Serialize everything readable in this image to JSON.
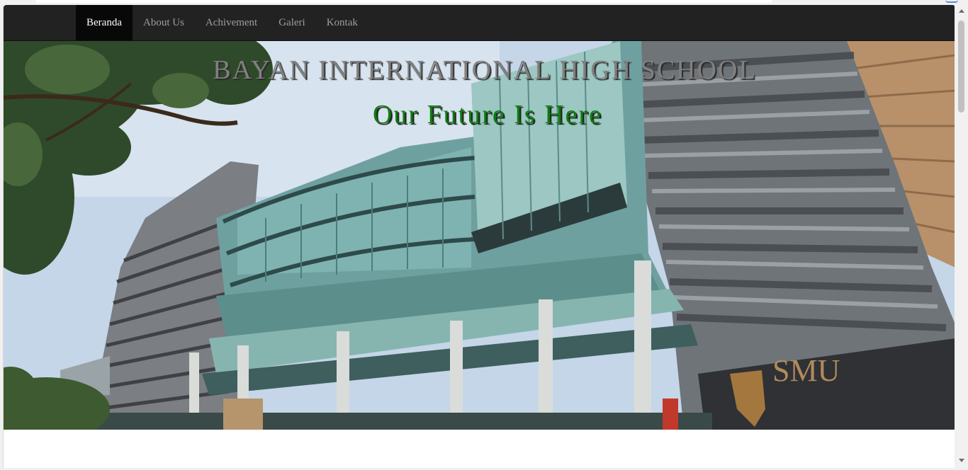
{
  "nav": {
    "items": [
      {
        "label": "Beranda",
        "active": true
      },
      {
        "label": "About Us",
        "active": false
      },
      {
        "label": "Achivement",
        "active": false
      },
      {
        "label": "Galeri",
        "active": false
      },
      {
        "label": "Kontak",
        "active": false
      }
    ]
  },
  "hero": {
    "title": "BAYAN INTERNATIONAL HIGH SCHOOL",
    "subtitle": "Our Future Is Here",
    "building_sign": "SMU"
  },
  "colors": {
    "navbar": "#222222",
    "nav_active": "#080808",
    "title": "#808080",
    "subtitle": "#107a10"
  }
}
